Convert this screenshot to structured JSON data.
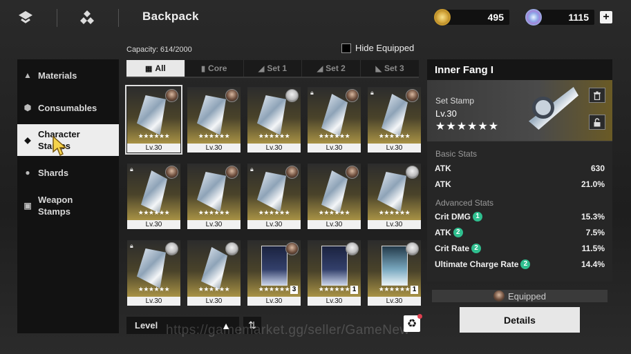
{
  "header": {
    "title": "Backpack",
    "currency1": {
      "value": "495",
      "icon": "gold-coin-icon"
    },
    "currency2": {
      "value": "1115",
      "icon": "gem-currency-icon"
    },
    "add_label": "+"
  },
  "sidebar": {
    "items": [
      {
        "label": "Materials",
        "icon": "flask-icon"
      },
      {
        "label": "Consumables",
        "icon": "hexagon-icon"
      },
      {
        "label": "Character Stamps",
        "icon": "stamp-icon",
        "active": true
      },
      {
        "label": "Shards",
        "icon": "person-icon"
      },
      {
        "label": "Weapon Stamps",
        "icon": "card-icon"
      }
    ]
  },
  "toolbar": {
    "capacity": "Capacity: 614/2000",
    "hide_equipped": "Hide Equipped"
  },
  "tabs": [
    {
      "label": "All",
      "active": true
    },
    {
      "label": "Core"
    },
    {
      "label": "Set 1"
    },
    {
      "label": "Set 2"
    },
    {
      "label": "Set 3"
    }
  ],
  "grid": {
    "items": [
      {
        "level": "Lv.30",
        "stars": "★★★★★★",
        "locked": false,
        "selected": true
      },
      {
        "level": "Lv.30",
        "stars": "★★★★★★",
        "locked": false
      },
      {
        "level": "Lv.30",
        "stars": "★★★★★★",
        "locked": false
      },
      {
        "level": "Lv.30",
        "stars": "★★★★★★",
        "locked": true
      },
      {
        "level": "Lv.30",
        "stars": "★★★★★★",
        "locked": true
      },
      {
        "level": "Lv.30",
        "stars": "★★★★★★",
        "locked": true
      },
      {
        "level": "Lv.30",
        "stars": "★★★★★★",
        "locked": false
      },
      {
        "level": "Lv.30",
        "stars": "★★★★★★",
        "locked": true
      },
      {
        "level": "Lv.30",
        "stars": "★★★★★★",
        "locked": false
      },
      {
        "level": "Lv.30",
        "stars": "★★★★★★",
        "locked": false
      },
      {
        "level": "Lv.30",
        "stars": "★★★★★★",
        "locked": true
      },
      {
        "level": "Lv.30",
        "stars": "★★★★★★",
        "locked": false
      },
      {
        "level": "Lv.30",
        "stars": "★★★★★★",
        "locked": false,
        "count": "3"
      },
      {
        "level": "Lv.30",
        "stars": "★★★★★★",
        "locked": false,
        "count": "1"
      },
      {
        "level": "Lv.30",
        "stars": "★★★★★★",
        "locked": false,
        "count": "1"
      }
    ]
  },
  "sort": {
    "label": "Level",
    "direction_icon": "▲",
    "toggle_icon": "⇅",
    "recycle_icon": "♻"
  },
  "detail": {
    "name": "Inner Fang I",
    "type": "Set Stamp",
    "level": "Lv.30",
    "stars": "★★★★★★",
    "basic_title": "Basic Stats",
    "basic": [
      {
        "name": "ATK",
        "value": "630"
      },
      {
        "name": "ATK",
        "value": "21.0%"
      }
    ],
    "advanced_title": "Advanced Stats",
    "advanced": [
      {
        "name": "Crit DMG",
        "rank": "1",
        "value": "15.3%"
      },
      {
        "name": "ATK",
        "rank": "2",
        "value": "7.5%"
      },
      {
        "name": "Crit Rate",
        "rank": "2",
        "value": "11.5%"
      },
      {
        "name": "Ultimate Charge Rate",
        "rank": "2",
        "value": "14.4%"
      }
    ],
    "equipped_label": "Equipped",
    "details_button": "Details"
  },
  "watermark": "https://gamemarket.gg/seller/GameNew"
}
